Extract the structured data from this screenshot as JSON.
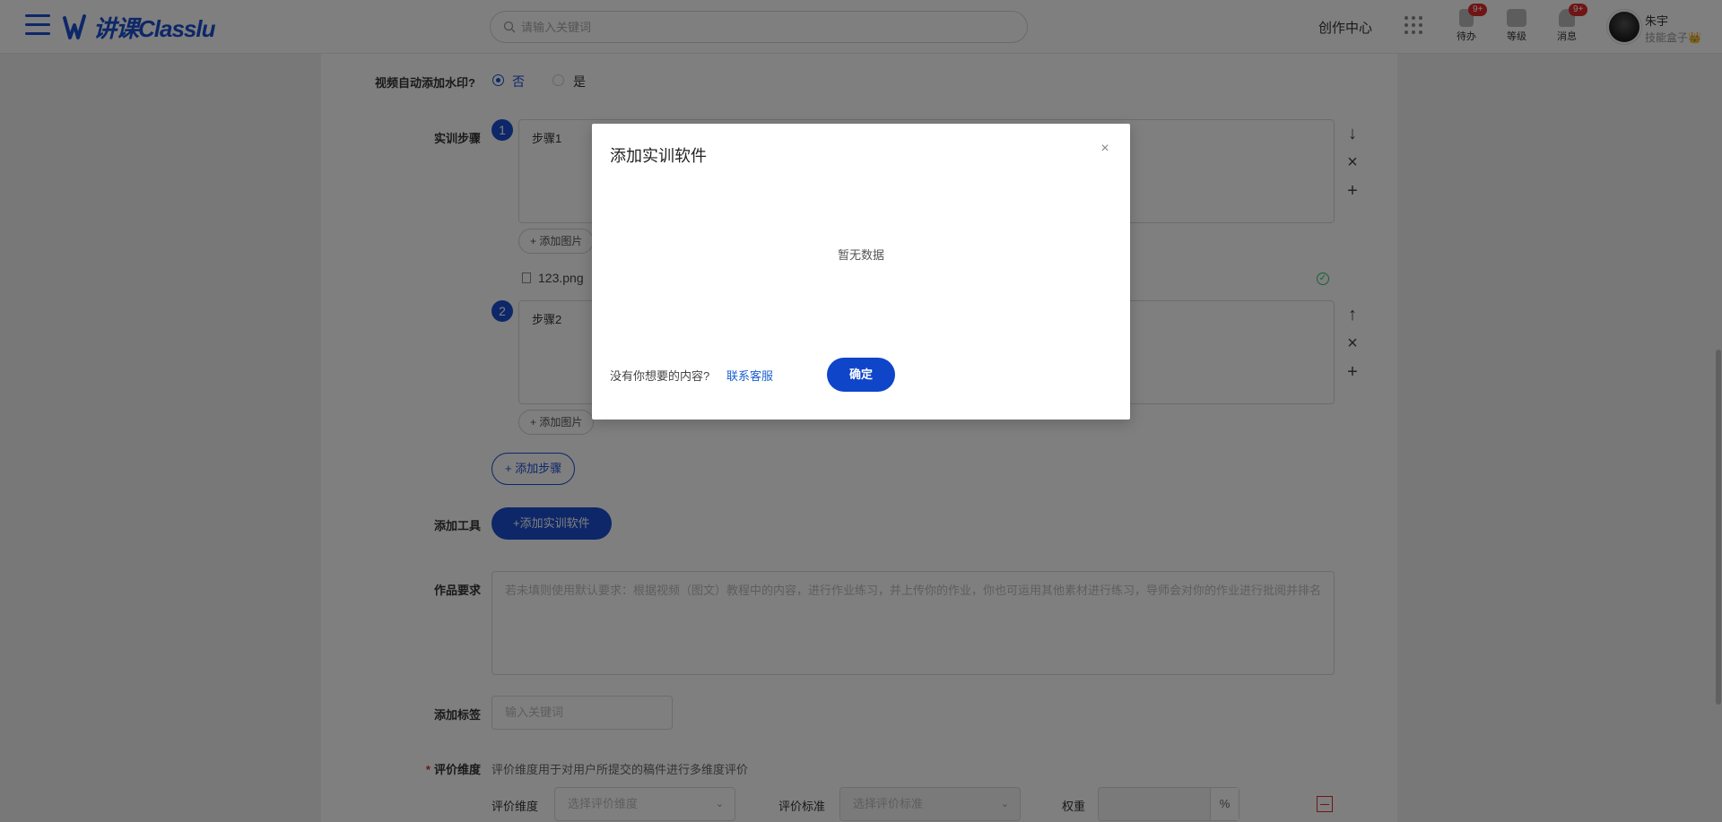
{
  "header": {
    "logo_text": "课Classlu",
    "logo_prefix": "讲",
    "search_placeholder": "请输入关键词",
    "create_center": "创作中心",
    "icons": [
      {
        "name": "todo",
        "label": "待办",
        "badge": "9+"
      },
      {
        "name": "level",
        "label": "等级",
        "badge": ""
      },
      {
        "name": "message",
        "label": "消息",
        "badge": "9+"
      }
    ],
    "user_name": "朱宇",
    "user_sub": "技能盒子👑"
  },
  "form": {
    "watermark_label": "视频自动添加水印?",
    "watermark_no": "否",
    "watermark_yes": "是",
    "steps_label": "实训步骤",
    "steps": [
      {
        "num": "1",
        "text": "步骤1",
        "add_image": "+ 添加图片",
        "file": "123.png"
      },
      {
        "num": "2",
        "text": "步骤2",
        "add_image": "+ 添加图片"
      }
    ],
    "add_step": "+ 添加步骤",
    "tools_label": "添加工具",
    "add_software": "+添加实训软件",
    "work_req_label": "作品要求",
    "work_req_placeholder": "若未填则使用默认要求：根据视频（图文）教程中的内容，进行作业练习，并上传你的作业，你也可运用其他素材进行练习，导师会对你的作业进行批阅并排名",
    "tags_label": "添加标签",
    "tags_placeholder": "输入关键词",
    "eval_required": "*",
    "eval_label": "评价维度",
    "eval_hint": "评价维度用于对用户所提交的稿件进行多维度评价",
    "eval_dim_label": "评价维度",
    "eval_dim_placeholder": "选择评价维度",
    "eval_std_label": "评价标准",
    "eval_std_placeholder": "选择评价标准",
    "weight_label": "权重",
    "weight_unit": "%"
  },
  "modal": {
    "title": "添加实训软件",
    "close": "×",
    "empty": "暂无数据",
    "question": "没有你想要的内容?",
    "contact": "联系客服",
    "confirm": "确定"
  }
}
